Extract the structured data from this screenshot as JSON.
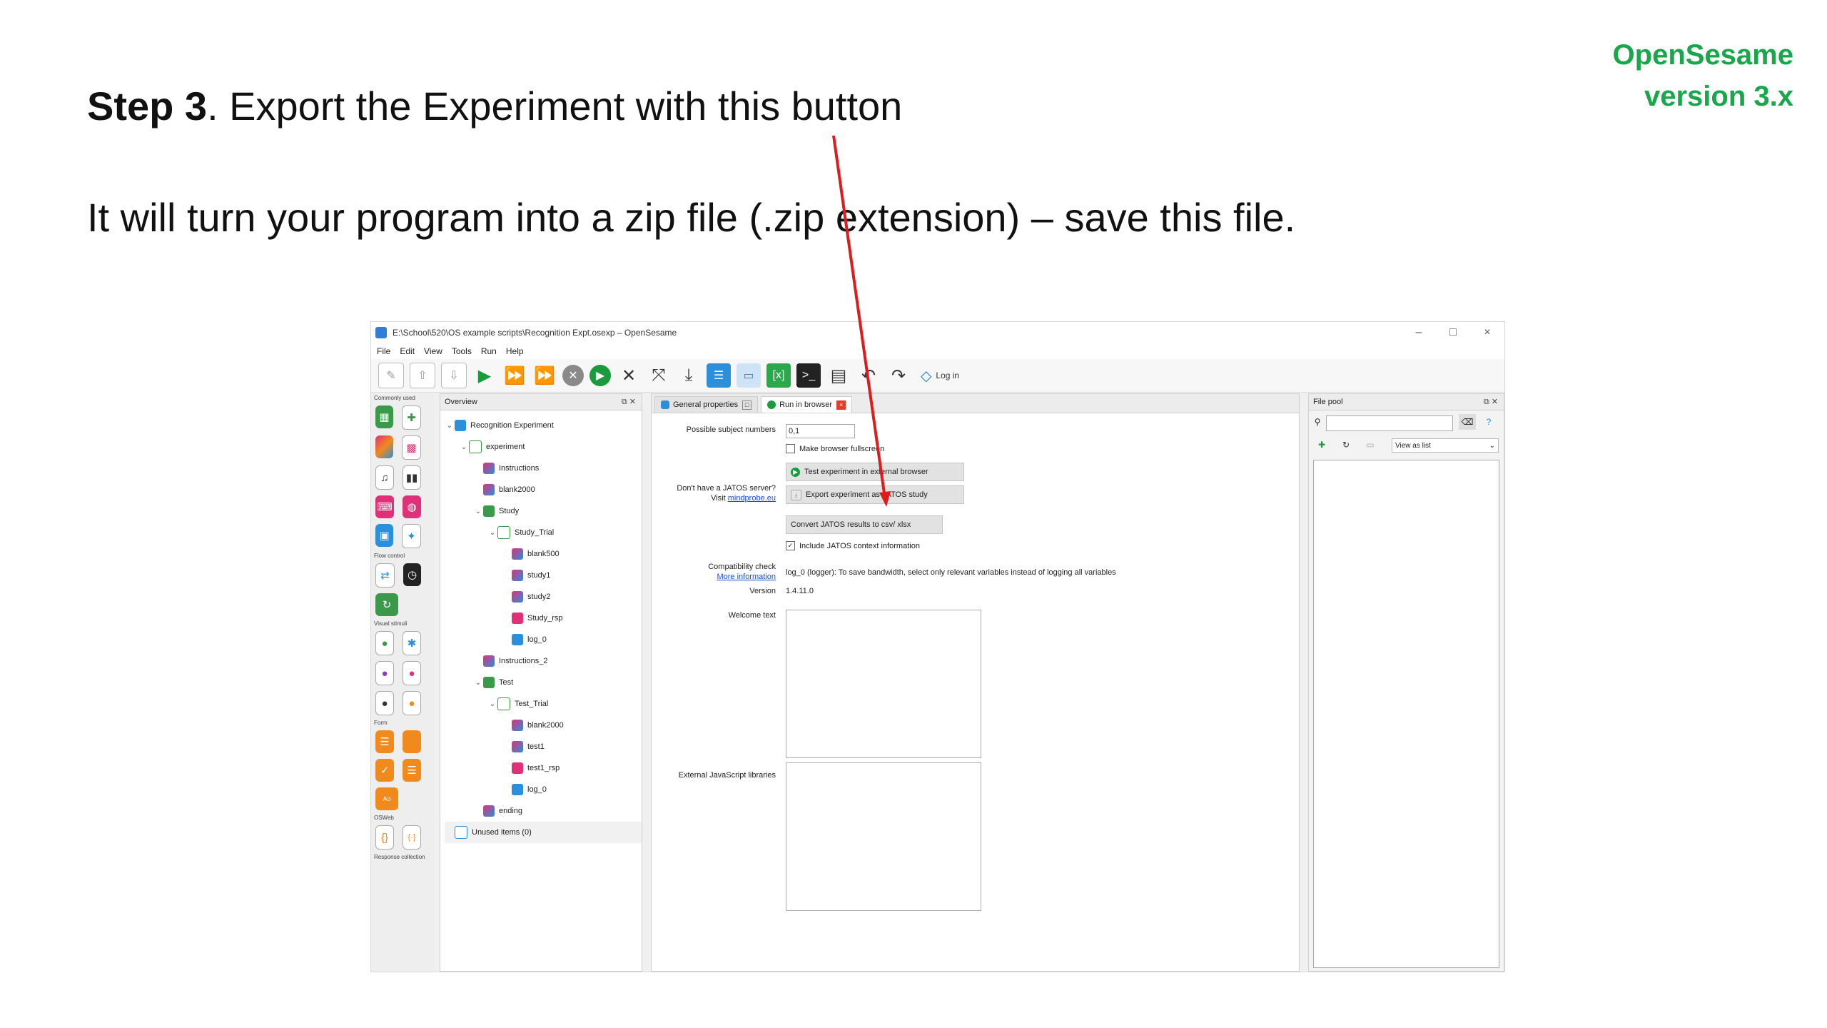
{
  "slide": {
    "step_label": "Step 3",
    "title_rest": ". Export the Experiment with this button",
    "body": "It will turn your program into a zip file (.zip extension) – save this file.",
    "brand_line1": "OpenSesame",
    "brand_line2": "version 3.x",
    "brand_color": "#1aa64a",
    "arrow_color": "#e01b1b"
  },
  "window": {
    "title": "E:\\School\\520\\OS example scripts\\Recognition Expt.osexp – OpenSesame",
    "controls": {
      "minimize": "–",
      "maximize": "□",
      "close": "×"
    },
    "menu": [
      "File",
      "Edit",
      "View",
      "Tools",
      "Run",
      "Help"
    ],
    "toolbar": {
      "login_label": "Log in",
      "icons": [
        "new-file-icon",
        "open-icon",
        "save-icon",
        "run-icon",
        "run-fast-icon",
        "run-quick-icon",
        "stop-icon",
        "resume-icon",
        "close-all-icon",
        "fullscreen-icon",
        "export-icon",
        "overview-icon",
        "folder-icon",
        "variables-icon",
        "console-icon",
        "debug-icon",
        "undo-icon",
        "redo-icon"
      ]
    }
  },
  "dock": {
    "sections": [
      "Commonly used",
      "Flow control",
      "Visual stimuli",
      "Form",
      "OSWeb",
      "Response collection"
    ],
    "colors": {
      "green": "#3a9a4a",
      "purple": "#8a3fb0",
      "pink": "#e0307a",
      "blue": "#2b8fdc",
      "orange": "#f08a1c",
      "black": "#222222"
    }
  },
  "overview": {
    "title": "Overview",
    "items": [
      "Recognition Experiment",
      "experiment",
      "Instructions",
      "blank2000",
      "Study",
      "Study_Trial",
      "blank500",
      "study1",
      "study2",
      "Study_rsp",
      "log_0",
      "Instructions_2",
      "Test",
      "Test_Trial",
      "blank2000",
      "test1",
      "test1_rsp",
      "log_0",
      "ending",
      "Unused items (0)"
    ]
  },
  "main": {
    "tabs": [
      "General properties",
      "Run in browser"
    ],
    "labels": {
      "subject_numbers": "Possible subject numbers",
      "no_jatos": "Don't have a JATOS server?",
      "visit": "Visit",
      "visit_link": "mindprobe.eu",
      "compat": "Compatibility check",
      "more_info": "More information",
      "version": "Version",
      "welcome": "Welcome text",
      "ext_js": "External JavaScript libraries"
    },
    "values": {
      "subject_numbers": "0,1",
      "make_fullscreen": "Make browser fullscreen",
      "test_button": "Test experiment in external browser",
      "export_button": "Export experiment as JATOS study",
      "convert_button": "Convert JATOS results to csv/ xlsx",
      "include_jatos": "Include JATOS context information",
      "compat_msg": "log_0 (logger): To save bandwidth, select only relevant variables instead of logging all variables",
      "version": "1.4.11.0"
    }
  },
  "pool": {
    "title": "File pool",
    "view_as": "View as list"
  }
}
